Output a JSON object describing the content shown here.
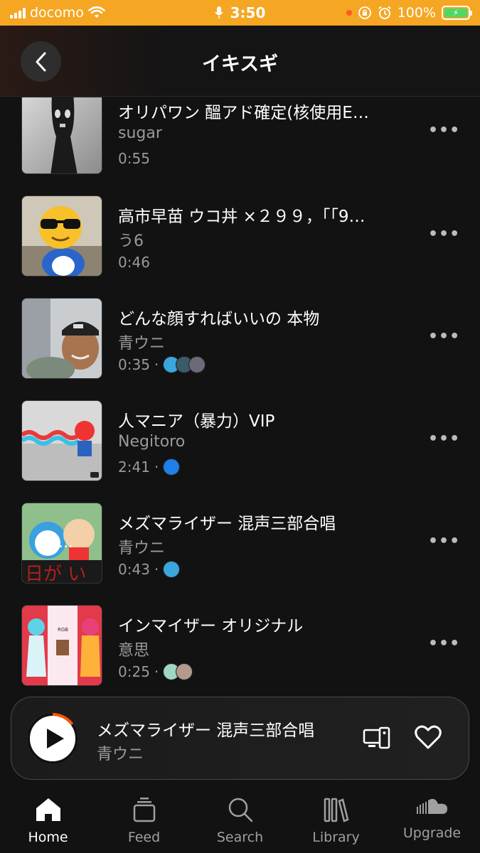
{
  "status_bar": {
    "carrier": "docomo",
    "time": "3:50",
    "battery": "100%"
  },
  "header": {
    "title": "イキスギ"
  },
  "tracks": [
    {
      "title": "オリパワン 醞アド確定(核使用E…",
      "artist": "sugar",
      "duration": "0:55",
      "avatars": []
    },
    {
      "title": "高市早苗 ウコ丼 ×２９９，「「9…",
      "artist": "う6",
      "duration": "0:46",
      "avatars": []
    },
    {
      "title": "どんな顔すればいいの 本物",
      "artist": "青ウニ",
      "duration": "0:35",
      "avatars": [
        "#3aa6dd",
        "#3b5b6b",
        "#6a6a78"
      ]
    },
    {
      "title": "人マニア（暴力）VIP",
      "artist": "Negitoro",
      "duration": "2:41",
      "avatars": [
        "#1e7fe6"
      ]
    },
    {
      "title": "メズマライザー 混声三部合唱",
      "artist": "青ウニ",
      "duration": "0:43",
      "avatars": [
        "#3aa6dd"
      ]
    },
    {
      "title": "インマイザー オリジナル",
      "artist": "意思",
      "duration": "0:25",
      "avatars": [
        "#9fd7c6",
        "#b49a8a"
      ]
    }
  ],
  "more_label": "•••",
  "meta_separator": "·",
  "mini_player": {
    "title": "メズマライザー 混声三部合唱",
    "artist": "青ウニ",
    "progress": 0.15
  },
  "tabs": [
    {
      "label": "Home",
      "icon": "home-icon",
      "active": true
    },
    {
      "label": "Feed",
      "icon": "feed-icon",
      "active": false
    },
    {
      "label": "Search",
      "icon": "search-icon",
      "active": false
    },
    {
      "label": "Library",
      "icon": "library-icon",
      "active": false
    },
    {
      "label": "Upgrade",
      "icon": "soundcloud-icon",
      "active": false
    }
  ],
  "colors": {
    "status_bar": "#f5a623",
    "accent": "#ff5500",
    "background": "#121212",
    "secondary_text": "#9a9a9a"
  }
}
